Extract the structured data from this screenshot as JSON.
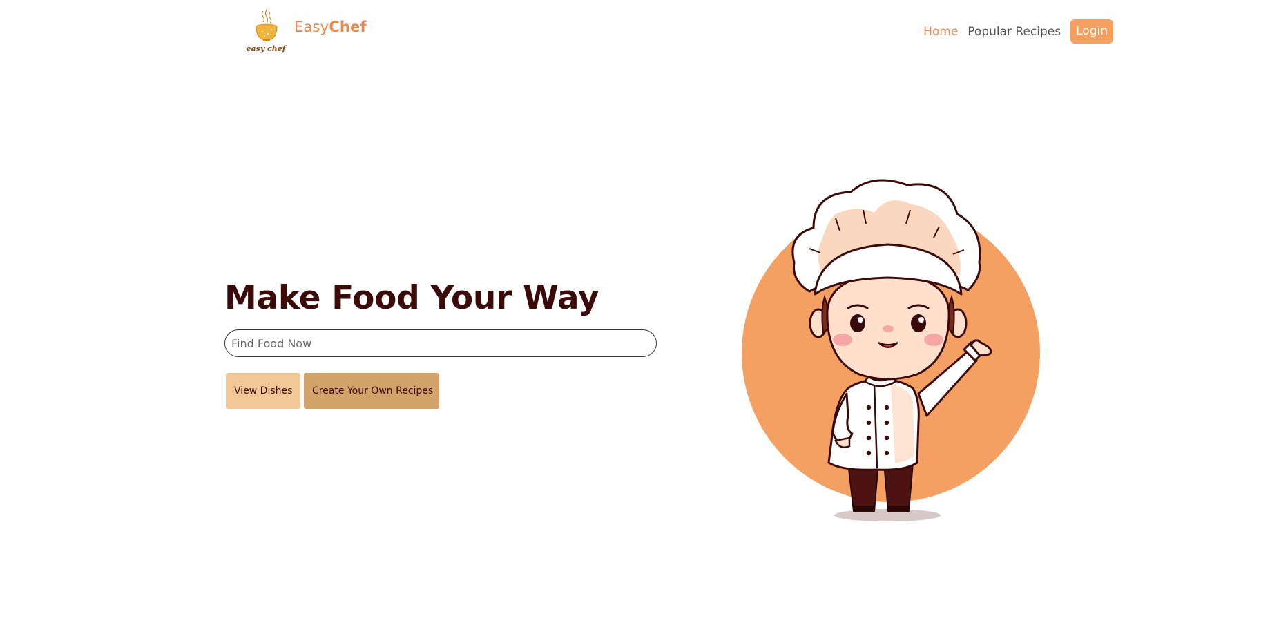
{
  "navbar": {
    "brand": {
      "logo_caption": "easy chef",
      "name_prefix": "Easy",
      "name_accent": "Chef"
    },
    "links": [
      {
        "label": "Home",
        "active": true
      },
      {
        "label": "Popular Recipes",
        "active": false
      }
    ],
    "login_label": "Login"
  },
  "hero": {
    "title": "Make Food Your Way",
    "search": {
      "placeholder": "Find Food Now",
      "value": ""
    },
    "buttons": {
      "view_dishes": "View Dishes",
      "create_recipes": "Create Your Own Recipes"
    }
  },
  "illustration": {
    "subject": "chef-mascot",
    "background_circle_color": "#f4a062"
  },
  "colors": {
    "accent": "#e8894e",
    "login_bg": "#f5a05f",
    "title": "#3d0a0a",
    "view_button_bg": "#f2c896",
    "create_button_bg": "#d2a46c"
  }
}
